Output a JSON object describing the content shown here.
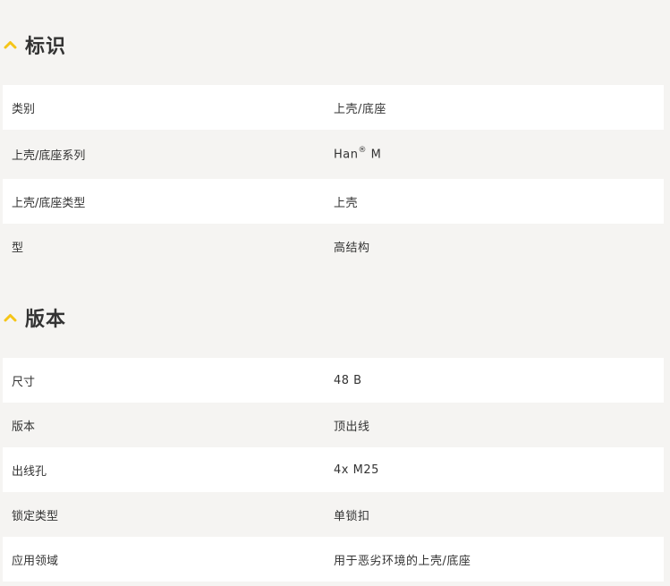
{
  "colors": {
    "accent": "#f5c518",
    "row_light": "#ffffff",
    "row_alt": "#f5f4f2",
    "text": "#333333"
  },
  "sections": [
    {
      "title": "标识",
      "icon": "chevron-up-icon",
      "rows": [
        {
          "label": "类别",
          "value": "上壳/底座"
        },
        {
          "label": "上壳/底座系列",
          "value": "Han",
          "value_sup": "®",
          "value_suffix": " M"
        },
        {
          "label": "上壳/底座类型",
          "value": "上壳"
        },
        {
          "label": "型",
          "value": "高结构"
        }
      ]
    },
    {
      "title": "版本",
      "icon": "chevron-up-icon",
      "rows": [
        {
          "label": "尺寸",
          "value": "48 B"
        },
        {
          "label": "版本",
          "value": "顶出线"
        },
        {
          "label": "出线孔",
          "value": "4x M25"
        },
        {
          "label": "锁定类型",
          "value": "单锁扣"
        },
        {
          "label": "应用领域",
          "value": "用于恶劣环境的上壳/底座"
        }
      ]
    }
  ]
}
